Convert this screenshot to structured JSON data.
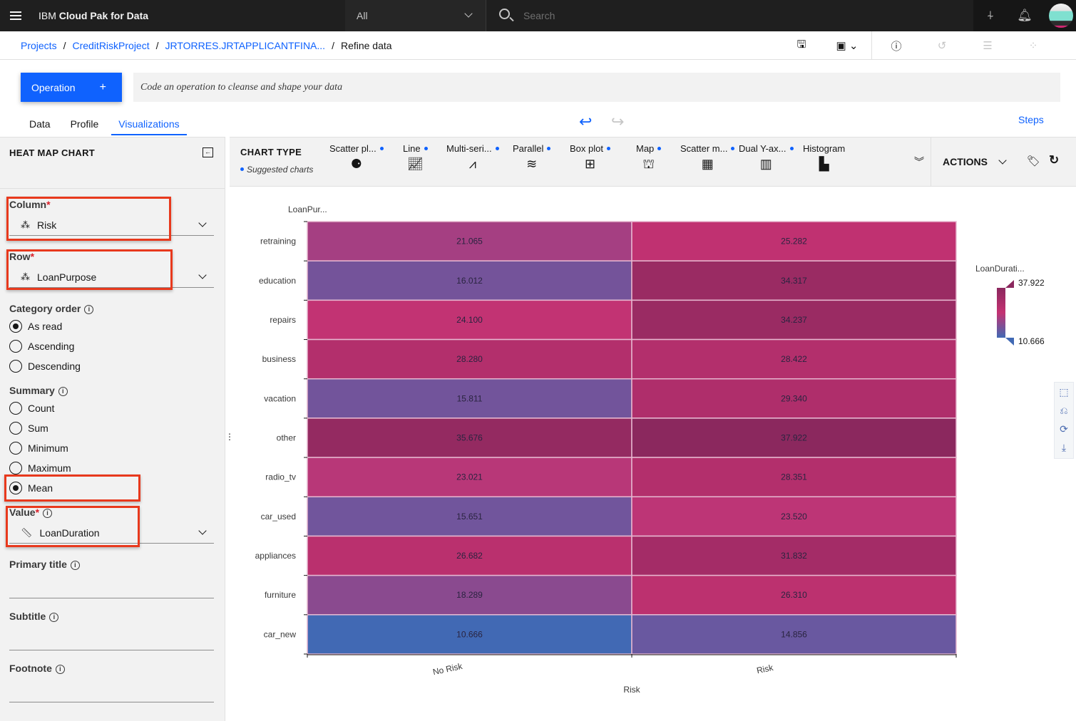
{
  "topbar": {
    "brand_prefix": "IBM",
    "brand_name": "Cloud Pak for Data",
    "scope_value": "All",
    "search_placeholder": "Search",
    "icons": [
      "menu-icon",
      "signpost-icon",
      "notification-icon",
      "avatar"
    ]
  },
  "breadcrumb": {
    "items": [
      {
        "label": "Projects",
        "link": true
      },
      {
        "label": "CreditRiskProject",
        "link": true
      },
      {
        "label": "JRTORRES.JRTAPPLICANTFINA...",
        "link": true
      },
      {
        "label": "Refine data",
        "link": false
      }
    ],
    "separator": "/"
  },
  "operation": {
    "button_label": "Operation",
    "button_icon": "+",
    "command_placeholder": "Code an operation to cleanse and shape your data"
  },
  "tabs": [
    {
      "label": "Data",
      "active": false
    },
    {
      "label": "Profile",
      "active": false
    },
    {
      "label": "Visualizations",
      "active": true
    }
  ],
  "steps_label": "Steps",
  "left_panel": {
    "title": "HEAT MAP CHART",
    "column": {
      "label": "Column",
      "required_mark": "*",
      "value": "Risk"
    },
    "row": {
      "label": "Row",
      "required_mark": "*",
      "value": "LoanPurpose"
    },
    "category_order": {
      "label": "Category order",
      "options": [
        {
          "label": "As read",
          "selected": true
        },
        {
          "label": "Ascending",
          "selected": false
        },
        {
          "label": "Descending",
          "selected": false
        }
      ]
    },
    "summary": {
      "label": "Summary",
      "options": [
        {
          "label": "Count",
          "selected": false
        },
        {
          "label": "Sum",
          "selected": false
        },
        {
          "label": "Minimum",
          "selected": false
        },
        {
          "label": "Maximum",
          "selected": false
        },
        {
          "label": "Mean",
          "selected": true
        }
      ]
    },
    "value": {
      "label": "Value",
      "required_mark": "*",
      "value": "LoanDuration"
    },
    "primary_title": {
      "label": "Primary title",
      "value": ""
    },
    "subtitle": {
      "label": "Subtitle",
      "value": ""
    },
    "footnote": {
      "label": "Footnote",
      "value": ""
    }
  },
  "chart_type_bar": {
    "title": "CHART TYPE",
    "suggested_label": "Suggested charts",
    "types": [
      {
        "label": "Scatter pl...",
        "suggested": true,
        "icon": "scatter-plot-icon"
      },
      {
        "label": "Line",
        "suggested": true,
        "icon": "line-chart-icon"
      },
      {
        "label": "Multi-seri...",
        "suggested": true,
        "icon": "multi-series-icon"
      },
      {
        "label": "Parallel",
        "suggested": true,
        "icon": "parallel-icon"
      },
      {
        "label": "Box plot",
        "suggested": true,
        "icon": "box-plot-icon"
      },
      {
        "label": "Map",
        "suggested": true,
        "icon": "map-icon"
      },
      {
        "label": "Scatter m...",
        "suggested": true,
        "icon": "scatter-matrix-icon"
      },
      {
        "label": "Dual Y-ax...",
        "suggested": true,
        "icon": "dual-y-axis-icon"
      },
      {
        "label": "Histogram",
        "suggested": false,
        "icon": "histogram-icon"
      }
    ],
    "actions_label": "ACTIONS"
  },
  "chart_data": {
    "type": "heatmap",
    "title": "",
    "xlabel": "Risk",
    "ylabel": "LoanPur...",
    "x_categories": [
      "No Risk",
      "Risk"
    ],
    "y_categories": [
      "retraining",
      "education",
      "repairs",
      "business",
      "vacation",
      "other",
      "radio_tv",
      "car_used",
      "appliances",
      "furniture",
      "car_new"
    ],
    "values": [
      [
        21.065,
        25.282
      ],
      [
        16.012,
        34.317
      ],
      [
        24.1,
        34.237
      ],
      [
        28.28,
        28.422
      ],
      [
        15.811,
        29.34
      ],
      [
        35.676,
        37.922
      ],
      [
        23.021,
        28.351
      ],
      [
        15.651,
        23.52
      ],
      [
        26.682,
        31.832
      ],
      [
        18.289,
        26.31
      ],
      [
        10.666,
        14.856
      ]
    ],
    "legend": {
      "title": "LoanDurati...",
      "min": 10.666,
      "max": 37.922,
      "placement": "right"
    },
    "colors": {
      "low": "#4169b4",
      "mid": "#c43272",
      "high": "#8b285e"
    }
  }
}
